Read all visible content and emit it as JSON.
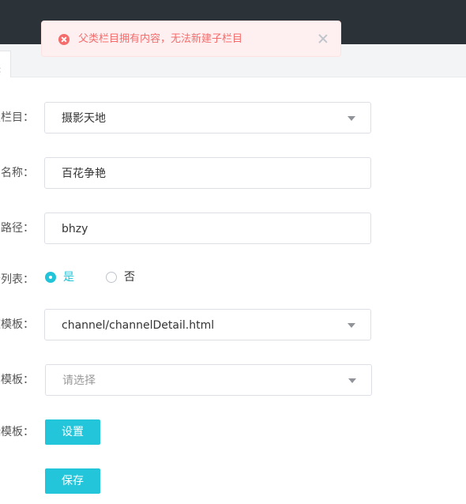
{
  "alert": {
    "message": "父类栏目拥有内容，无法新建子栏目",
    "icon": "error-circle-icon",
    "color": "#f56c6c"
  },
  "tab": {
    "close_glyph": "×"
  },
  "form": {
    "parent": {
      "label": "级栏目：",
      "value": "摄影天地"
    },
    "name": {
      "label": "目名称：",
      "value": "百花争艳"
    },
    "path": {
      "label": "目路径：",
      "value": "bhzy"
    },
    "is_list": {
      "label": "否列表：",
      "options": [
        "是",
        "否"
      ],
      "selected": "是"
    },
    "channel_template": {
      "label": "道模板：",
      "value": "channel/channelDetail.html"
    },
    "content_template": {
      "label": "容模板：",
      "placeholder": "请选择"
    },
    "mobile_template": {
      "label": "端模板：",
      "button": "设置"
    },
    "save_button": "保存"
  },
  "colors": {
    "accent": "#22c5da",
    "topbar": "#2b3238"
  }
}
